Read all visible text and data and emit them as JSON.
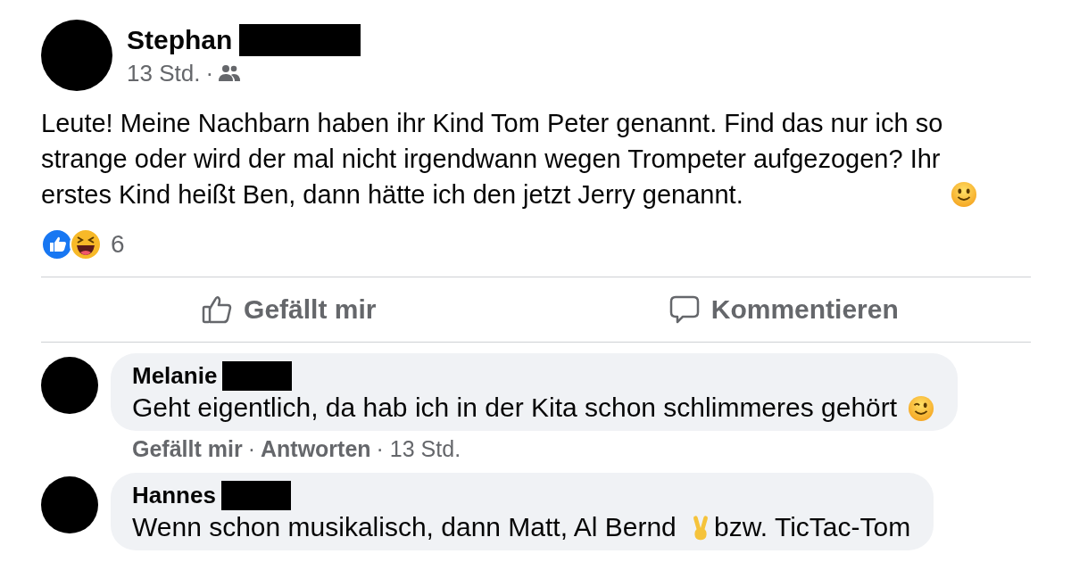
{
  "post": {
    "author": "Stephan",
    "time": "13 Std.",
    "separator": "·",
    "text": "Leute! Meine Nachbarn haben ihr Kind Tom Peter genannt. Find das nur ich so strange oder wird der mal nicht irgendwann wegen Trompeter aufgezogen? Ihr erstes Kind heißt Ben, dann hätte ich den jetzt Jerry genannt.",
    "reaction_count": "6"
  },
  "actions": [
    {
      "kind": "like",
      "label": "Gefällt mir"
    },
    {
      "kind": "comment",
      "label": "Kommentieren"
    }
  ],
  "comments": [
    {
      "author": "Melanie",
      "segments": [
        {
          "kind": "text",
          "text": "Geht eigentlich, da hab ich in der Kita schon schlimmeres gehört"
        },
        {
          "kind": "wink"
        }
      ],
      "meta": [
        {
          "kind": "link",
          "text": "Gefällt mir"
        },
        {
          "kind": "plain",
          "text": "·"
        },
        {
          "kind": "link",
          "text": "Antworten"
        },
        {
          "kind": "plain",
          "text": "· 13 Std."
        }
      ]
    },
    {
      "author": "Hannes",
      "segments": [
        {
          "kind": "text",
          "text": "Wenn schon musikalisch, dann Matt, Al Bernd"
        },
        {
          "kind": "victory"
        },
        {
          "kind": "text",
          "text": "bzw. TicTac-Tom"
        }
      ]
    }
  ]
}
